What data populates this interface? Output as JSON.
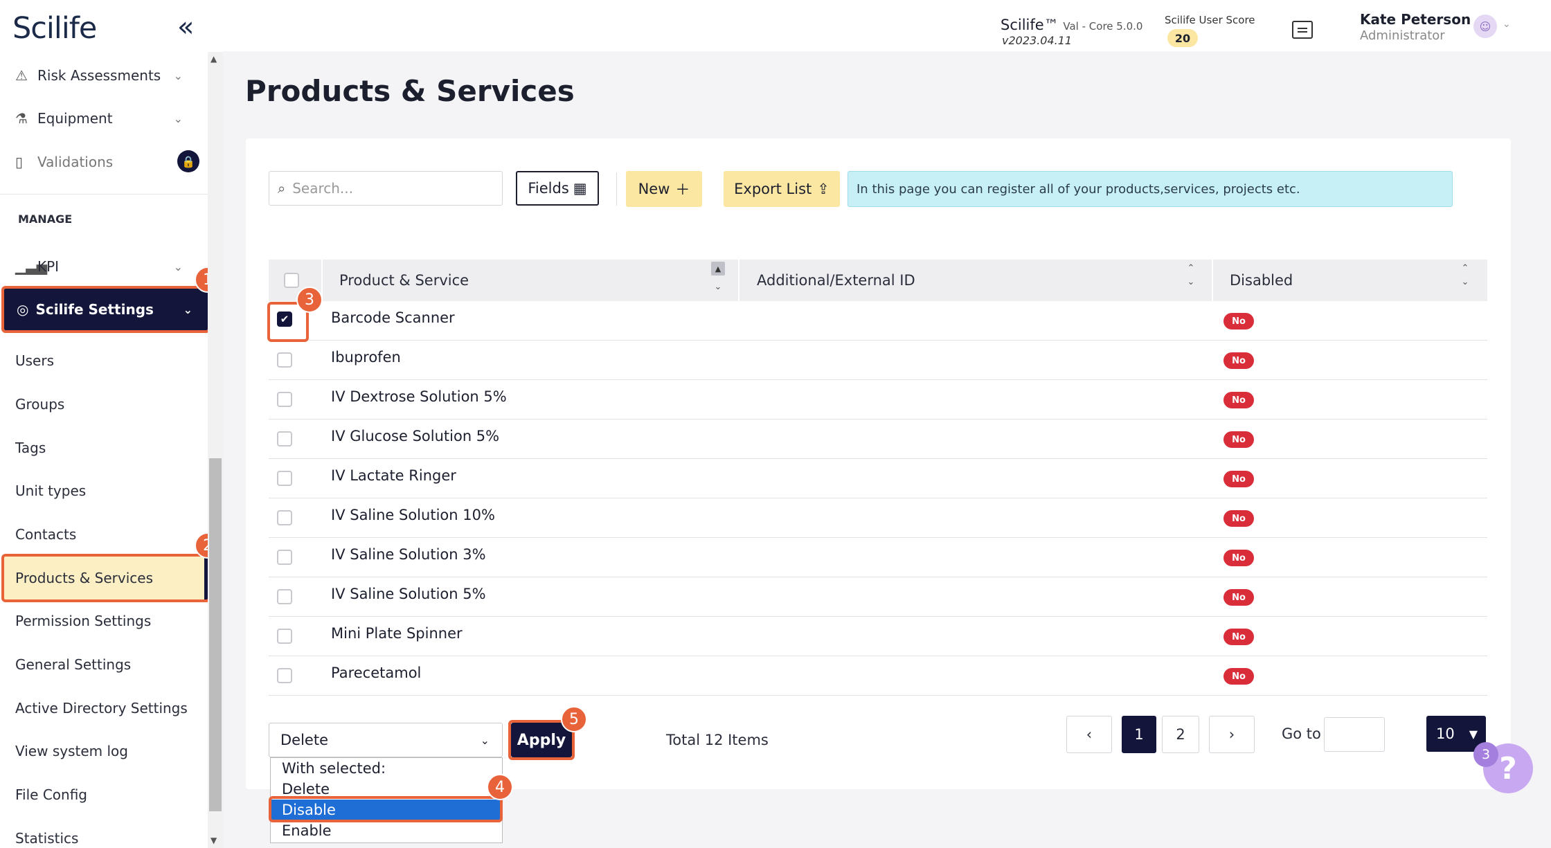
{
  "sidebar": {
    "logo": "Scilife",
    "collapse_icon": "«",
    "top_items": [
      {
        "label": "Risk Assessments",
        "icon": "⚠"
      },
      {
        "label": "Equipment",
        "icon": "⚠"
      },
      {
        "label": "Validations",
        "icon": "📋"
      }
    ],
    "section_label": "MANAGE",
    "kpi_label": "KPI",
    "settings_label": "Scilife Settings",
    "sub_items": [
      "Users",
      "Groups",
      "Tags",
      "Unit types",
      "Contacts",
      "Products & Services",
      "Permission Settings",
      "General Settings",
      "Active Directory Settings",
      "View system log",
      "File Config",
      "Statistics"
    ]
  },
  "header": {
    "product_name": "Scilife™",
    "product_edition": "Val - Core 5.0.0",
    "version": "v2023.04.11",
    "score_label": "Scilife User Score",
    "score_value": "20",
    "user_name": "Kate Peterson",
    "user_role": "Administrator"
  },
  "page": {
    "title": "Products & Services",
    "search_placeholder": "Search...",
    "fields_label": "Fields",
    "new_label": "New",
    "export_label": "Export List",
    "info_text": "In this page you can register all of your products,services, projects etc."
  },
  "table": {
    "columns": [
      "Product & Service",
      "Additional/External ID",
      "Disabled"
    ],
    "rows": [
      {
        "name": "Barcode Scanner",
        "id": "",
        "disabled": "No",
        "checked": true
      },
      {
        "name": "Ibuprofen",
        "id": "",
        "disabled": "No",
        "checked": false
      },
      {
        "name": "IV Dextrose Solution 5%",
        "id": "",
        "disabled": "No",
        "checked": false
      },
      {
        "name": "IV Glucose Solution 5%",
        "id": "",
        "disabled": "No",
        "checked": false
      },
      {
        "name": "IV Lactate Ringer",
        "id": "",
        "disabled": "No",
        "checked": false
      },
      {
        "name": "IV Saline Solution 10%",
        "id": "",
        "disabled": "No",
        "checked": false
      },
      {
        "name": "IV Saline Solution 3%",
        "id": "",
        "disabled": "No",
        "checked": false
      },
      {
        "name": "IV Saline Solution 5%",
        "id": "",
        "disabled": "No",
        "checked": false
      },
      {
        "name": "Mini Plate Spinner",
        "id": "",
        "disabled": "No",
        "checked": false
      },
      {
        "name": "Parecetamol",
        "id": "",
        "disabled": "No",
        "checked": false
      }
    ]
  },
  "bulk": {
    "selected_action": "Delete",
    "options": [
      "With selected:",
      "Delete",
      "Disable",
      "Enable"
    ],
    "highlighted_option": "Disable",
    "apply_label": "Apply"
  },
  "pagination": {
    "total_text": "Total 12 Items",
    "pages": [
      "1",
      "2"
    ],
    "current_page": "1",
    "prev": "‹",
    "next": "›",
    "goto_label": "Go to",
    "page_size": "10"
  },
  "annotations": [
    "1",
    "2",
    "3",
    "4",
    "5"
  ],
  "help": {
    "count": "3",
    "icon": "?"
  },
  "colors": {
    "accent": "#13163a",
    "highlight": "#e8623a",
    "yellow": "#fbe7a1",
    "danger": "#d92d3a",
    "info": "#c7f0f6"
  }
}
